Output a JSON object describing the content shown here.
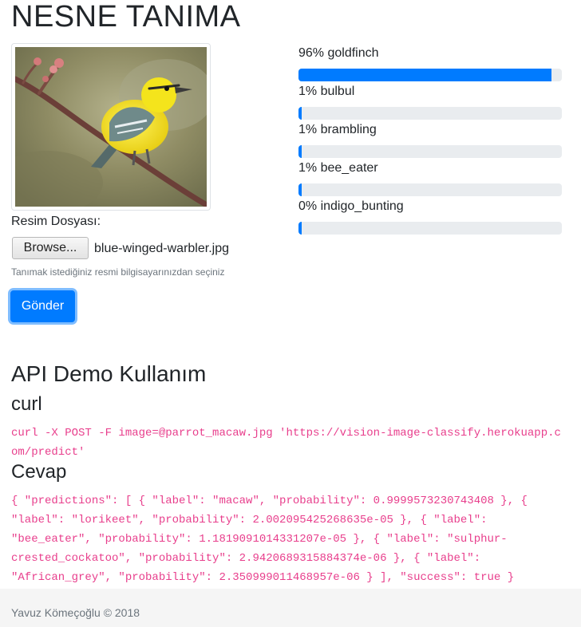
{
  "page": {
    "title": "NESNE TANIMA"
  },
  "form": {
    "file_label": "Resim Dosyası:",
    "browse_label": "Browse...",
    "file_name": "blue-winged-warbler.jpg",
    "help_text": "Tanımak istediğiniz resmi bilgisayarınızdan seçiniz",
    "submit_label": "Gönder"
  },
  "predictions": [
    {
      "label": "96% goldfinch",
      "percent": 96
    },
    {
      "label": "1% bulbul",
      "percent": 1
    },
    {
      "label": "1% brambling",
      "percent": 1
    },
    {
      "label": "1% bee_eater",
      "percent": 1
    },
    {
      "label": "0% indigo_bunting",
      "percent": 0
    }
  ],
  "api": {
    "title": "API Demo Kullanım",
    "curl_title": "curl",
    "curl_command": "curl -X POST -F image=@parrot_macaw.jpg 'https://vision-image-classify.herokuapp.com/predict'",
    "response_title": "Cevap",
    "response_body": "{ \"predictions\": [ { \"label\": \"macaw\", \"probability\": 0.9999573230743408 }, { \"label\": \"lorikeet\", \"probability\": 2.002095425268635e-05 }, { \"label\": \"bee_eater\", \"probability\": 1.1819091014331207e-05 }, { \"label\": \"sulphur-crested_cockatoo\", \"probability\": 2.9420689315884374e-06 }, { \"label\": \"African_grey\", \"probability\": 2.350999011468957e-06 } ], \"success\": true }"
  },
  "footer": {
    "text": "Yavuz Kömeçoğlu © 2018"
  },
  "colors": {
    "primary": "#007bff",
    "code": "#e83e8c",
    "bar_track": "#e9ecef",
    "footer_bg": "#f5f5f5"
  }
}
